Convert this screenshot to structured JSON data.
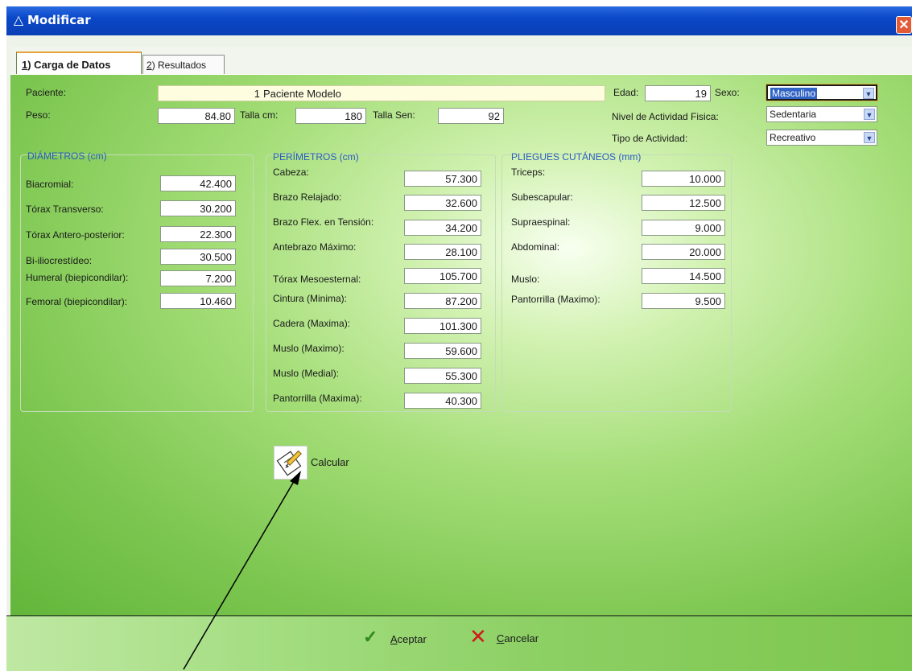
{
  "window": {
    "title": "Modificar",
    "title_icon": "warning-triangle-icon",
    "close_glyph": "✕"
  },
  "tabs": [
    {
      "label_prefix": "1",
      "label": ") Carga de Datos"
    },
    {
      "label_prefix": "2",
      "label": ") Resultados"
    }
  ],
  "header": {
    "paciente_label": "Paciente:",
    "paciente_num": "1",
    "paciente_nombre": "Paciente Modelo",
    "edad_label": "Edad:",
    "edad_value": "19",
    "sexo_label": "Sexo:",
    "sexo_value": "Masculino",
    "peso_label": "Peso:",
    "peso_value": "84.80",
    "talla_label": "Talla cm:",
    "talla_value": "180",
    "talla_sen_label": "Talla Sen:",
    "talla_sen_value": "92",
    "nivel_label": "Nivel de  Actividad Fisica:",
    "nivel_value": "Sedentaria",
    "tipo_label": "Tipo de Actividad:",
    "tipo_value": "Recreativo"
  },
  "diametros": {
    "title": "DIÁMETROS (cm)",
    "items": [
      {
        "label": "Biacromial:",
        "value": "42.400"
      },
      {
        "label": "Tórax Transverso:",
        "value": "30.200"
      },
      {
        "label": "Tórax Antero-posterior:",
        "value": "22.300"
      },
      {
        "label": "Bi-iliocrestídeo:",
        "value": "30.500"
      },
      {
        "label": "Humeral (biepicondilar):",
        "value": "7.200"
      },
      {
        "label": "Femoral (biepicondilar):",
        "value": "10.460"
      }
    ]
  },
  "perimetros": {
    "title": "PERÍMETROS (cm)",
    "items": [
      {
        "label": "Cabeza:",
        "value": "57.300"
      },
      {
        "label": "Brazo Relajado:",
        "value": "32.600"
      },
      {
        "label": "Brazo Flex. en Tensión:",
        "value": "34.200"
      },
      {
        "label": "Antebrazo Máximo:",
        "value": "28.100"
      },
      {
        "label": "Tórax Mesoesternal:",
        "value": "105.700"
      },
      {
        "label": "Cintura (Minima):",
        "value": "87.200"
      },
      {
        "label": "Cadera (Maxima):",
        "value": "101.300"
      },
      {
        "label": "Muslo (Maximo):",
        "value": "59.600"
      },
      {
        "label": "Muslo (Medial):",
        "value": "55.300"
      },
      {
        "label": "Pantorrilla (Maxima):",
        "value": "40.300"
      }
    ]
  },
  "pliegues": {
    "title": "PLIEGUES CUTÁNEOS (mm)",
    "items": [
      {
        "label": "Triceps:",
        "value": "10.000"
      },
      {
        "label": "Subescapular:",
        "value": "12.500"
      },
      {
        "label": "Supraespinal:",
        "value": "9.000"
      },
      {
        "label": "Abdominal:",
        "value": "20.000"
      },
      {
        "label": "Muslo:",
        "value": "14.500"
      },
      {
        "label": "Pantorrilla (Maximo):",
        "value": "9.500"
      }
    ]
  },
  "calcular": {
    "label": "Calcular",
    "icon": "notepad-pencil-icon"
  },
  "footer": {
    "aceptar_u": "A",
    "aceptar_rest": "ceptar",
    "aceptar_icon": "checkmark-icon",
    "cancelar_u": "C",
    "cancelar_rest": "ancelar",
    "cancelar_icon": "x-mark-icon"
  },
  "colors": {
    "title_bar": "#0b48c8",
    "panel_green": "#8ccf63",
    "group_title": "#2a5dc0",
    "highlight": "#3164c4"
  }
}
